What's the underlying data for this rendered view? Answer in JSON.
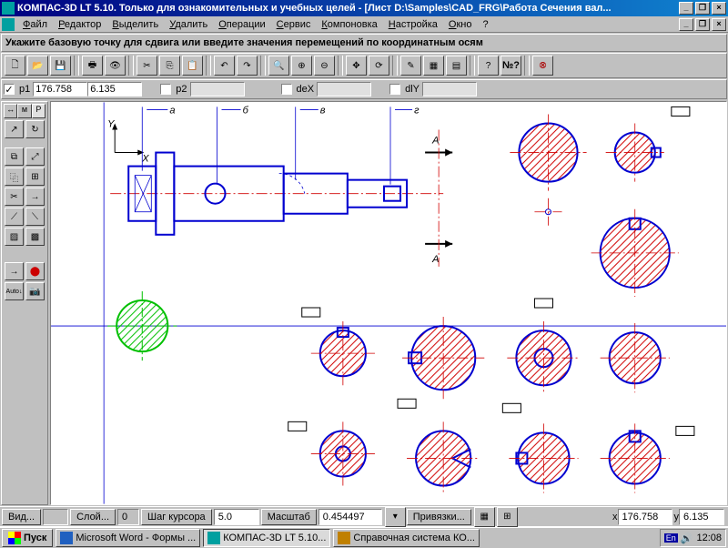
{
  "window": {
    "title": "КОМПАС-3D LT 5.10. Только для ознакомительных и учебных целей - [Лист D:\\Samples\\CAD_FRG\\Работа Сечения вал...",
    "minimize": "_",
    "maximize": "❐",
    "close": "×"
  },
  "menu": {
    "file": "Файл",
    "editor": "Редактор",
    "select": "Выделить",
    "delete": "Удалить",
    "operations": "Операции",
    "service": "Сервис",
    "layout": "Компоновка",
    "settings": "Настройка",
    "window": "Окно",
    "help": "?"
  },
  "hint": "Укажите базовую точку для сдвига или введите значения перемещений по координатным осям",
  "coord": {
    "p1_label": "p1",
    "p1x": "176.758",
    "p1y": "6.135",
    "p2_label": "p2",
    "p2x": "",
    "p2y": "",
    "dex_label": "deX",
    "dex": "",
    "dly_label": "dlY",
    "dly": ""
  },
  "status": {
    "view": "Вид...",
    "layer": "Слой...",
    "layer_num": "0",
    "step_label": "Шаг курсора",
    "step": "5.0",
    "scale_label": "Масштаб",
    "scale": "0.454497",
    "snap": "Привязки...",
    "x_label": "x",
    "x": "176.758",
    "y_label": "y",
    "y": "6.135"
  },
  "taskbar": {
    "start": "Пуск",
    "task1": "Microsoft Word - Формы ...",
    "task2": "КОМПАС-3D LT 5.10...",
    "task3": "Справочная система КО...",
    "lang": "En",
    "time": "12:08"
  },
  "drawing": {
    "labels": {
      "a": "а",
      "b": "б",
      "c": "в",
      "d": "г"
    },
    "section": "А",
    "axis_x": "X",
    "axis_y": "Y"
  },
  "tabs": [
    "↔",
    "м",
    "P"
  ]
}
